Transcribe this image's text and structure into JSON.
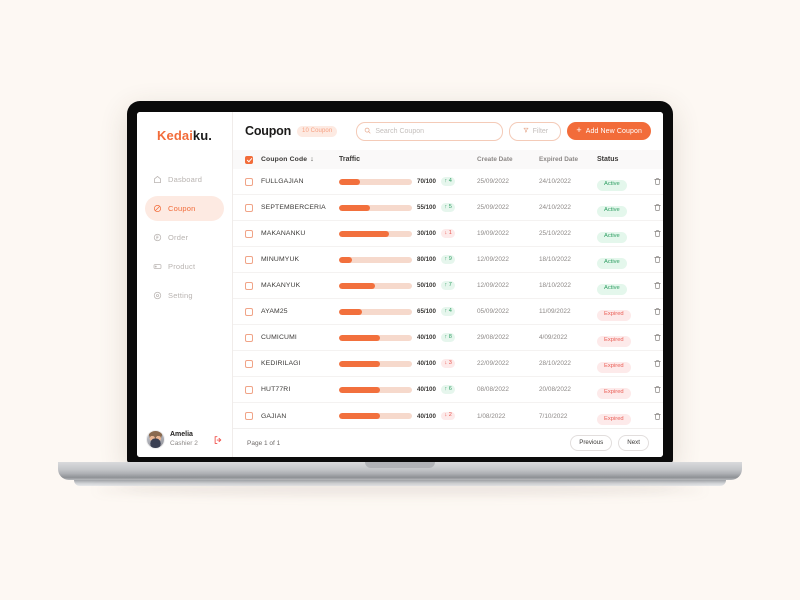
{
  "brand": {
    "part1": "Kedai",
    "part2": "ku."
  },
  "sidebar": {
    "items": [
      {
        "label": "Dasboard",
        "icon": "home-icon"
      },
      {
        "label": "Coupon",
        "icon": "coupon-icon"
      },
      {
        "label": "Order",
        "icon": "order-icon"
      },
      {
        "label": "Product",
        "icon": "product-icon"
      },
      {
        "label": "Setting",
        "icon": "settings-icon"
      }
    ],
    "profile": {
      "name": "Amelia",
      "role": "Cashier 2",
      "logout_icon": "logout-icon"
    }
  },
  "header": {
    "title": "Coupon",
    "count_badge": "10 Coupon",
    "search_placeholder": "Search Coupon",
    "filter_label": "Filter",
    "add_label": "Add New Coupon"
  },
  "table": {
    "columns": {
      "code": "Coupon Code",
      "sort_arrow": "↓",
      "traffic": "Traffic",
      "create_date": "Create Date",
      "expired_date": "Expired Date",
      "status": "Status"
    },
    "header_checked": true,
    "rows": [
      {
        "checked": false,
        "code": "FULLGAJIAN",
        "traffic_value": "70/100",
        "bar_percent": 29,
        "delta": "4",
        "delta_dir": "up",
        "create_date": "25/09/2022",
        "expired_date": "24/10/2022",
        "status": "Active"
      },
      {
        "checked": false,
        "code": "SEPTEMBERCERIA",
        "traffic_value": "55/100",
        "bar_percent": 43,
        "delta": "5",
        "delta_dir": "up",
        "create_date": "25/09/2022",
        "expired_date": "24/10/2022",
        "status": "Active"
      },
      {
        "checked": false,
        "code": "MAKANANKU",
        "traffic_value": "30/100",
        "bar_percent": 68,
        "delta": "1",
        "delta_dir": "down",
        "create_date": "19/09/2022",
        "expired_date": "25/10/2022",
        "status": "Active"
      },
      {
        "checked": false,
        "code": "MINUMYUK",
        "traffic_value": "80/100",
        "bar_percent": 18,
        "delta": "9",
        "delta_dir": "up",
        "create_date": "12/09/2022",
        "expired_date": "18/10/2022",
        "status": "Active"
      },
      {
        "checked": false,
        "code": "MAKANYUK",
        "traffic_value": "50/100",
        "bar_percent": 49,
        "delta": "7",
        "delta_dir": "up",
        "create_date": "12/09/2022",
        "expired_date": "18/10/2022",
        "status": "Active"
      },
      {
        "checked": false,
        "code": "AYAM25",
        "traffic_value": "65/100",
        "bar_percent": 31,
        "delta": "4",
        "delta_dir": "up",
        "create_date": "05/09/2022",
        "expired_date": "11/09/2022",
        "status": "Expired"
      },
      {
        "checked": false,
        "code": "CUMICUMI",
        "traffic_value": "40/100",
        "bar_percent": 56,
        "delta": "8",
        "delta_dir": "up",
        "create_date": "29/08/2022",
        "expired_date": "4/09/2022",
        "status": "Expired"
      },
      {
        "checked": false,
        "code": "KEDIRILAGI",
        "traffic_value": "40/100",
        "bar_percent": 56,
        "delta": "3",
        "delta_dir": "down",
        "create_date": "22/09/2022",
        "expired_date": "28/10/2022",
        "status": "Expired"
      },
      {
        "checked": false,
        "code": "HUT77RI",
        "traffic_value": "40/100",
        "bar_percent": 56,
        "delta": "6",
        "delta_dir": "up",
        "create_date": "08/08/2022",
        "expired_date": "20/08/2022",
        "status": "Expired"
      },
      {
        "checked": false,
        "code": "GAJIAN",
        "traffic_value": "40/100",
        "bar_percent": 56,
        "delta": "2",
        "delta_dir": "down",
        "create_date": "1/08/2022",
        "expired_date": "7/10/2022",
        "status": "Expired"
      }
    ],
    "row_action_icons": [
      "trash-icon",
      "edit-pencil-icon"
    ]
  },
  "footer": {
    "page_info": "Page 1 of 1",
    "previous_label": "Previous",
    "next_label": "Next"
  },
  "colors": {
    "accent": "#f26c3a",
    "accent_soft": "#fdeae2",
    "bar_track": "#f6d9cc",
    "status_active_bg": "#e4f7ec",
    "status_active_text": "#2f9e63",
    "status_expired_bg": "#fdeaea",
    "status_expired_text": "#ea5f57",
    "page_bg": "#fdf8f3"
  }
}
